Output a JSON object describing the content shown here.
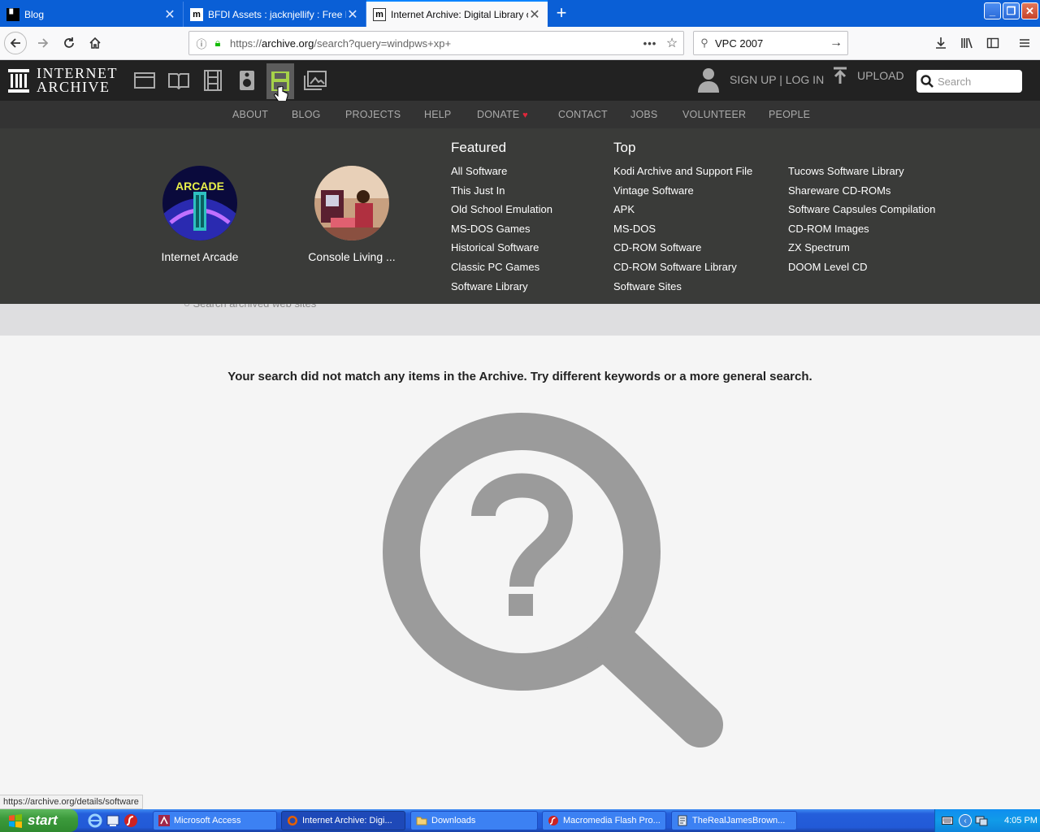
{
  "browser": {
    "tabs": [
      {
        "title": "Blog",
        "favicon": "blog-favicon",
        "active": false
      },
      {
        "title": "BFDI Assets : jacknjellify : Free Do",
        "favicon": "internet-archive-favicon",
        "active": false
      },
      {
        "title": "Internet Archive: Digital Library of",
        "favicon": "internet-archive-favicon",
        "active": true
      }
    ],
    "url_prefix": "https://",
    "url_domain": "archive.org",
    "url_rest": "/search?query=windpws+xp+",
    "search_value": "VPC 2007",
    "accent": "#0a84ff"
  },
  "ia": {
    "logo_line1": "INTERNET",
    "logo_line2": "ARCHIVE",
    "signup": "SIGN UP | LOG IN",
    "upload": "UPLOAD",
    "search_placeholder": "Search",
    "media_icons": [
      "web-icon",
      "texts-icon",
      "video-icon",
      "audio-icon",
      "software-icon",
      "images-icon"
    ],
    "selected_media": "software-icon",
    "highlight_color": "#a6d249"
  },
  "subnav": [
    "ABOUT",
    "BLOG",
    "PROJECTS",
    "HELP",
    "DONATE",
    "CONTACT",
    "JOBS",
    "VOLUNTEER",
    "PEOPLE"
  ],
  "panel": {
    "tiles": [
      {
        "label": "Internet Arcade",
        "image_text": "INTERNET ARCADE"
      },
      {
        "label": "Console Living ..."
      }
    ],
    "featured_heading": "Featured",
    "featured": [
      "All Software",
      "This Just In",
      "Old School Emulation",
      "MS-DOS Games",
      "Historical Software",
      "Classic PC Games",
      "Software Library"
    ],
    "top_heading": "Top",
    "top": [
      "Kodi Archive and Support File",
      "Vintage Software",
      "APK",
      "MS-DOS",
      "CD-ROM Software",
      "CD-ROM Software Library",
      "Software Sites"
    ],
    "top2": [
      "Tucows Software Library",
      "Shareware CD-ROMs",
      "Software Capsules Compilation",
      "CD-ROM Images",
      "ZX Spectrum",
      "DOOM Level CD"
    ]
  },
  "page": {
    "ghost_option": "Search archived web sites",
    "no_results": "Your search did not match any items in the Archive. Try different keywords or a more general search."
  },
  "status_url": "https://archive.org/details/software",
  "taskbar": {
    "start": "start",
    "tasks": [
      "Microsoft Access",
      "Internet Archive: Digi...",
      "Downloads",
      "Macromedia Flash Pro...",
      "TheRealJamesBrown..."
    ],
    "clock": "4:05 PM"
  }
}
